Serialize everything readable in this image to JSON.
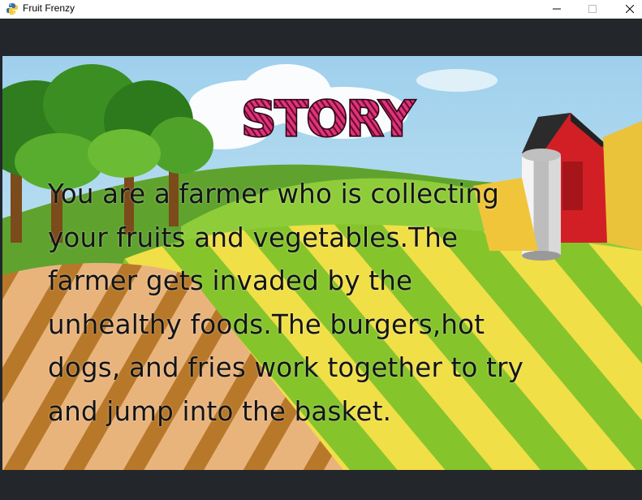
{
  "window": {
    "title": "Fruit Frenzy",
    "icon": "python-snake-icon"
  },
  "screen": {
    "heading": "STORY",
    "story_lines": [
      "You are a farmer who is collecting",
      "your fruits and vegetables.The",
      "farmer gets invaded by the",
      "unhealthy foods.The burgers,hot",
      "dogs, and fries work together to try",
      "and jump into the basket."
    ]
  },
  "colors": {
    "letterbox": "#23262b",
    "sky": "#bfe3f3",
    "heading_fill": "#c2195e",
    "heading_outline": "#3a0a22",
    "barn_red": "#d21f25",
    "field_green": "#7bbf2a",
    "field_yellow": "#f2e14a",
    "path_tan": "#e7b27a",
    "path_brown": "#b8782a"
  }
}
